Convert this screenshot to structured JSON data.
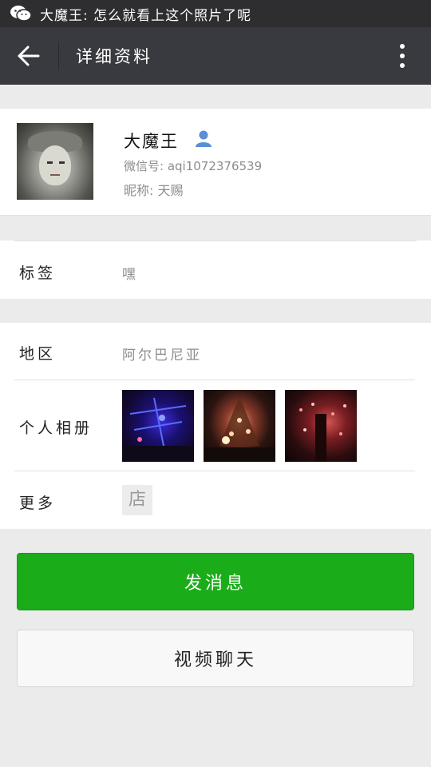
{
  "status_bar": {
    "notification": "大魔王: 怎么就看上这个照片了呢",
    "app_icon": "wechat-icon"
  },
  "title_bar": {
    "title": "详细资料",
    "back_icon": "back-arrow-icon",
    "more_icon": "more-vertical-icon"
  },
  "profile": {
    "name": "大魔王",
    "wechat_id": "微信号: aqi1072376539",
    "nickname": "昵称: 天赐",
    "contact_icon": "contact-person-icon",
    "accent_color": "#5b8ed8"
  },
  "tags": {
    "label": "标签",
    "value": "嘿"
  },
  "region": {
    "label": "地区",
    "value": "阿尔巴尼亚"
  },
  "album": {
    "label": "个人相册",
    "photos": [
      "photo-blue-lights",
      "photo-christmas-tree",
      "photo-red-lights"
    ]
  },
  "more": {
    "label": "更多",
    "shop_icon_text": "店"
  },
  "actions": {
    "send_message": "发消息",
    "video_chat": "视频聊天",
    "send_color": "#1aad19"
  }
}
